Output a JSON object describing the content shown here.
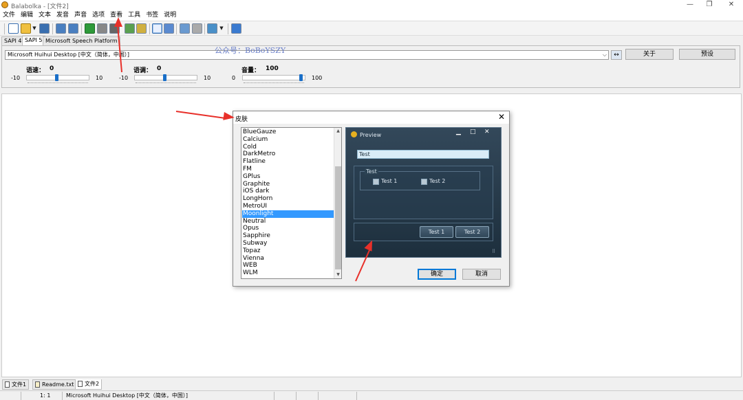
{
  "window": {
    "title": "Balabolka - [文件2]",
    "minimize_glyph": "—",
    "restore_glyph": "❐",
    "close_glyph": "✕"
  },
  "menu": [
    "文件",
    "编辑",
    "文本",
    "发音",
    "声音",
    "选项",
    "查看",
    "工具",
    "书签",
    "说明"
  ],
  "engine_tabs": [
    "SAPI 4",
    "SAPI 5",
    "Microsoft Speech Platform"
  ],
  "watermark": "公众号：BoBoYSZY",
  "voice": {
    "selected": "Microsoft Huihui Desktop [中文（简体，中国）]",
    "about_label": "关于",
    "preset_label": "预设"
  },
  "sliders": [
    {
      "label": "语速：",
      "value": "0",
      "min": "-10",
      "max": "10",
      "level": 0.5
    },
    {
      "label": "语调：",
      "value": "0",
      "min": "-10",
      "max": "10",
      "level": 0.5
    },
    {
      "label": "音量：",
      "value": "100",
      "min": "0",
      "max": "100",
      "level": 1.0
    }
  ],
  "dialog": {
    "title": "皮肤",
    "close_glyph": "✕",
    "skins": [
      "BlueGauze",
      "Calcium",
      "Cold",
      "DarkMetro",
      "Flatline",
      "FM",
      "GPlus",
      "Graphite",
      "iOS dark",
      "LongHorn",
      "MetroUI",
      "Moonlight",
      "Neutral",
      "Opus",
      "Sapphire",
      "Subway",
      "Topaz",
      "Vienna",
      "WEB",
      "WLM"
    ],
    "selected_skin": "Moonlight",
    "preview": {
      "title": "Preview",
      "input_value": "Test",
      "group_label": "Test",
      "check1": "Test 1",
      "check2": "Test 2",
      "button1": "Test 1",
      "button2": "Test 2",
      "min_glyph": "▁",
      "max_glyph": "□",
      "close_glyph": "✕"
    },
    "ok_label": "确定",
    "cancel_label": "取消"
  },
  "doc_tabs": [
    "文件1",
    "Readme.txt",
    "文件2"
  ],
  "active_doc_tab": "文件2",
  "status": {
    "position": "1:   1",
    "voice": "Microsoft Huihui Desktop [中文（简体，中国）]"
  },
  "colors": {
    "accent": "#3399ff",
    "arrow": "#e8302a",
    "preview_bg": "#2a3e4f"
  }
}
